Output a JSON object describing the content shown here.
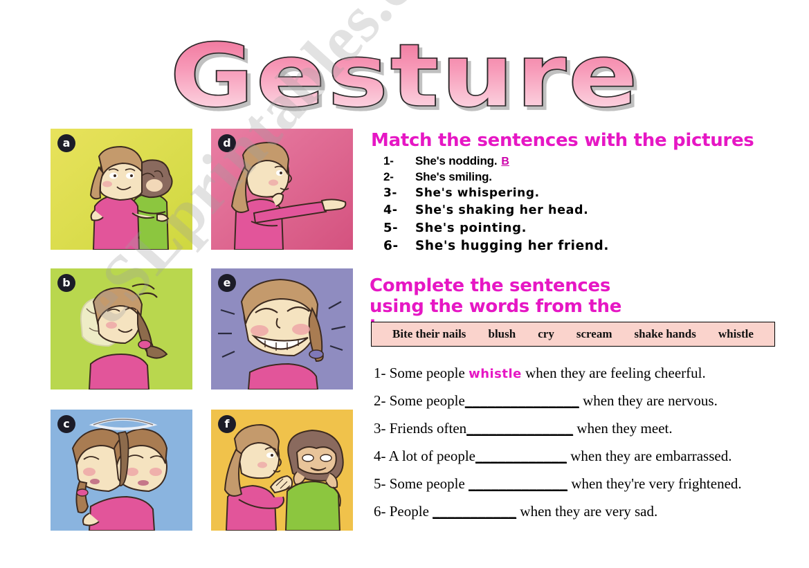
{
  "title": "Gesture",
  "watermark": "eSLprintables.com",
  "exercise1": {
    "heading": "Match the sentences with the pictures",
    "items": [
      {
        "num": "1-",
        "text": "She's nodding.",
        "answer": "B"
      },
      {
        "num": "2-",
        "text": "She's smiling.",
        "answer": ""
      },
      {
        "num": "3-",
        "text": "She's whispering.",
        "answer": ""
      },
      {
        "num": "4-",
        "text": "She's shaking her head.",
        "answer": ""
      },
      {
        "num": "5-",
        "text": "She's pointing.",
        "answer": ""
      },
      {
        "num": "6-",
        "text": "She's hugging her friend.",
        "answer": ""
      }
    ]
  },
  "exercise2": {
    "heading": "Complete the sentences using the words from the box",
    "wordbank": [
      "Bite their nails",
      "blush",
      "cry",
      "scream",
      "shake hands",
      "whistle"
    ],
    "sentences": [
      {
        "num": "1-",
        "before": "Some people ",
        "filled": "whistle",
        "blank": "",
        "after": " when they are feeling cheerful."
      },
      {
        "num": "2-",
        "before": "Some people",
        "filled": "",
        "blank": "_______________",
        "after": " when they are nervous."
      },
      {
        "num": "3-",
        "before": "Friends often",
        "filled": "",
        "blank": "______________",
        "after": " when they meet."
      },
      {
        "num": "4-",
        "before": " A lot of people",
        "filled": "",
        "blank": "____________",
        "after": "  when they are embarrassed."
      },
      {
        "num": "5-",
        "before": "Some people ",
        "filled": "",
        "blank": "_____________",
        "after": " when they're very frightened."
      },
      {
        "num": "6-",
        "before": "People ",
        "filled": "",
        "blank": "___________",
        "after": " when they are very sad."
      }
    ]
  },
  "pictures": [
    {
      "letter": "a",
      "caption": "two girls hugging",
      "bg": "#dfdb4a"
    },
    {
      "letter": "d",
      "caption": "girl pointing",
      "bg": "#e0648f"
    },
    {
      "letter": "b",
      "caption": "girl nodding",
      "bg": "#b9d74e"
    },
    {
      "letter": "e",
      "caption": "girl smiling",
      "bg": "#8f8cc0"
    },
    {
      "letter": "c",
      "caption": "girl shaking her head",
      "bg": "#8ab4df"
    },
    {
      "letter": "f",
      "caption": "girl whispering to friend",
      "bg": "#f0c24b"
    }
  ]
}
